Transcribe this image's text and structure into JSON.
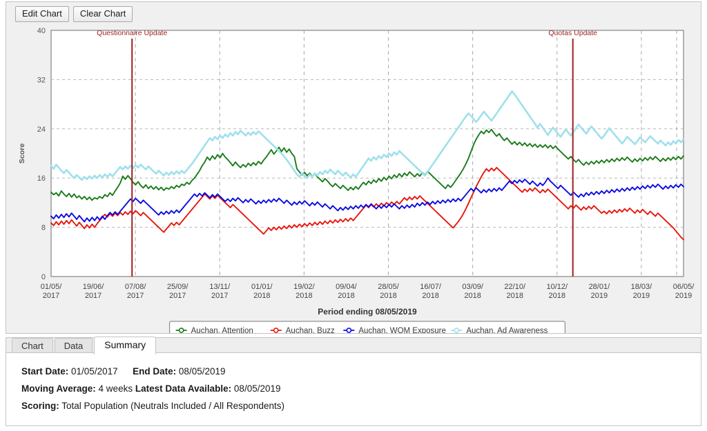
{
  "toolbar": {
    "edit_chart_label": "Edit Chart",
    "clear_chart_label": "Clear Chart"
  },
  "tabs": [
    {
      "label": "Chart",
      "active": false
    },
    {
      "label": "Data",
      "active": false
    },
    {
      "label": "Summary",
      "active": true
    }
  ],
  "summary": {
    "start_date_label": "Start Date:",
    "start_date_value": "01/05/2017",
    "end_date_label": "End Date:",
    "end_date_value": "08/05/2019",
    "moving_average_label": "Moving Average:",
    "moving_average_value": "4 weeks",
    "latest_data_label": "Latest Data Available:",
    "latest_data_value": "08/05/2019",
    "scoring_label": "Scoring:",
    "scoring_value": "Total Population (Neutrals Included / All Respondents)"
  },
  "chart_data": {
    "type": "line",
    "title": "",
    "xlabel": "Period ending 08/05/2019",
    "ylabel": "Score",
    "ylim": [
      0,
      40
    ],
    "yticks": [
      0,
      8,
      16,
      24,
      32,
      40
    ],
    "grid": true,
    "legend_position": "bottom",
    "xticklabels": [
      "01/05/\n2017",
      "19/06/\n2017",
      "07/08/\n2017",
      "25/09/\n2017",
      "13/11/\n2017",
      "01/01/\n2018",
      "19/02/\n2018",
      "09/04/\n2018",
      "28/05/\n2018",
      "16/07/\n2018",
      "03/09/\n2018",
      "22/10/\n2018",
      "10/12/\n2018",
      "28/01/\n2019",
      "18/03/\n2019",
      "06/05/\n2019"
    ],
    "annotations": [
      {
        "label": "Questionnaire Update",
        "x_fraction": 0.128,
        "color": "#9e1f1f"
      },
      {
        "label": "Quotas Update",
        "x_fraction": 0.825,
        "color": "#9e1f1f"
      }
    ],
    "series": [
      {
        "name": "Auchan, Attention",
        "color": "#1a7a1a",
        "values": [
          13.7,
          13.3,
          13.6,
          13.1,
          13.9,
          13.4,
          13.0,
          13.5,
          12.9,
          13.4,
          12.8,
          13.1,
          12.6,
          13.0,
          12.5,
          12.9,
          12.4,
          12.8,
          12.6,
          13.0,
          12.7,
          13.3,
          13.0,
          13.6,
          13.2,
          13.9,
          14.5,
          15.2,
          16.3,
          15.8,
          16.4,
          15.9,
          15.3,
          14.9,
          15.4,
          14.8,
          14.4,
          14.9,
          14.3,
          14.7,
          14.2,
          14.6,
          14.1,
          14.5,
          14.0,
          14.4,
          14.2,
          14.6,
          14.3,
          14.8,
          14.5,
          15.0,
          14.8,
          15.3,
          15.0,
          15.6,
          16.0,
          16.6,
          17.2,
          18.0,
          18.6,
          19.4,
          18.9,
          19.6,
          19.1,
          19.8,
          19.3,
          20.0,
          19.4,
          19.0,
          18.5,
          18.0,
          18.6,
          18.1,
          17.7,
          18.2,
          17.8,
          18.4,
          18.0,
          18.5,
          18.1,
          18.7,
          18.3,
          18.9,
          19.4,
          20.0,
          20.6,
          19.9,
          20.4,
          21.0,
          20.3,
          20.9,
          20.2,
          20.7,
          20.0,
          19.5,
          17.5,
          17.0,
          16.5,
          16.9,
          16.4,
          16.8,
          16.3,
          16.7,
          16.2,
          15.8,
          15.4,
          15.9,
          15.5,
          15.0,
          14.6,
          15.1,
          14.7,
          14.3,
          14.8,
          14.4,
          14.0,
          14.5,
          14.1,
          14.6,
          14.2,
          14.8,
          15.3,
          14.9,
          15.5,
          15.1,
          15.7,
          15.3,
          15.9,
          15.5,
          16.1,
          15.7,
          16.3,
          15.9,
          16.5,
          16.1,
          16.7,
          16.2,
          16.8,
          16.4,
          17.0,
          16.6,
          16.2,
          16.7,
          16.3,
          16.9,
          16.5,
          17.1,
          16.7,
          16.3,
          15.9,
          15.5,
          15.1,
          14.7,
          14.3,
          14.9,
          14.5,
          15.0,
          15.6,
          16.2,
          16.8,
          17.5,
          18.3,
          19.2,
          20.3,
          21.4,
          22.3,
          23.0,
          23.6,
          23.2,
          23.8,
          23.4,
          23.9,
          23.3,
          22.8,
          23.2,
          22.6,
          22.1,
          22.5,
          22.0,
          21.5,
          21.9,
          21.4,
          21.8,
          21.3,
          21.7,
          21.2,
          21.6,
          21.1,
          21.5,
          21.0,
          21.4,
          21.0,
          21.4,
          20.9,
          21.3,
          20.8,
          21.2,
          20.7,
          20.3,
          19.9,
          19.5,
          19.1,
          19.5,
          19.0,
          18.6,
          19.0,
          18.5,
          18.1,
          18.6,
          18.2,
          18.7,
          18.3,
          18.8,
          18.4,
          18.9,
          18.5,
          19.0,
          18.6,
          19.1,
          18.7,
          19.2,
          18.8,
          19.3,
          18.9,
          19.4,
          19.0,
          18.6,
          19.1,
          18.7,
          19.2,
          18.8,
          19.3,
          18.9,
          19.4,
          19.0,
          19.5,
          19.1,
          18.7,
          19.2,
          18.8,
          19.3,
          18.9,
          19.4,
          19.0,
          19.5,
          19.1,
          19.6
        ]
      },
      {
        "name": "Auchan, Buzz",
        "color": "#e8160c",
        "values": [
          8.7,
          8.3,
          8.9,
          8.4,
          9.0,
          8.5,
          9.1,
          8.6,
          9.2,
          8.7,
          8.2,
          8.8,
          8.3,
          7.8,
          8.4,
          7.9,
          8.5,
          8.0,
          8.6,
          9.1,
          9.6,
          10.1,
          9.7,
          10.2,
          9.8,
          10.3,
          9.9,
          10.4,
          10.0,
          10.5,
          10.1,
          10.6,
          10.2,
          10.7,
          10.3,
          9.9,
          10.4,
          10.0,
          9.6,
          9.2,
          8.8,
          8.4,
          8.0,
          7.6,
          7.2,
          7.7,
          8.2,
          8.7,
          8.3,
          8.8,
          8.4,
          8.9,
          9.4,
          9.9,
          10.4,
          10.9,
          11.4,
          11.9,
          12.4,
          12.9,
          13.4,
          13.0,
          12.6,
          13.1,
          12.7,
          13.2,
          12.8,
          12.4,
          12.0,
          11.6,
          11.2,
          11.7,
          11.3,
          10.9,
          10.5,
          10.1,
          9.7,
          9.3,
          8.9,
          8.5,
          8.1,
          7.7,
          7.3,
          6.9,
          7.4,
          7.9,
          7.5,
          8.0,
          7.6,
          8.1,
          7.7,
          8.2,
          7.8,
          8.3,
          7.9,
          8.4,
          8.0,
          8.5,
          8.1,
          8.6,
          8.2,
          8.7,
          8.3,
          8.8,
          8.4,
          8.9,
          8.5,
          9.0,
          8.6,
          9.1,
          8.7,
          9.2,
          8.8,
          9.3,
          8.9,
          9.4,
          9.0,
          9.5,
          9.1,
          9.6,
          10.1,
          10.6,
          11.1,
          11.6,
          11.2,
          11.7,
          11.3,
          11.8,
          11.4,
          11.9,
          11.5,
          12.0,
          11.6,
          12.1,
          11.7,
          12.2,
          11.8,
          12.3,
          12.8,
          12.4,
          12.9,
          12.5,
          13.0,
          12.6,
          13.1,
          12.7,
          12.3,
          11.9,
          11.5,
          11.1,
          10.7,
          10.3,
          9.9,
          9.5,
          9.1,
          8.7,
          8.3,
          7.9,
          8.4,
          8.9,
          9.5,
          10.2,
          11.0,
          11.9,
          12.8,
          13.7,
          14.6,
          15.4,
          16.2,
          16.9,
          17.5,
          17.1,
          17.6,
          17.2,
          17.7,
          17.3,
          16.9,
          16.5,
          16.1,
          15.7,
          15.3,
          14.9,
          14.5,
          14.1,
          13.7,
          14.2,
          13.8,
          14.3,
          13.9,
          14.4,
          14.0,
          13.6,
          14.1,
          13.7,
          14.2,
          13.8,
          13.4,
          13.0,
          12.6,
          12.2,
          11.8,
          11.4,
          11.0,
          11.5,
          11.1,
          11.6,
          11.2,
          10.8,
          11.3,
          10.9,
          11.4,
          11.0,
          11.5,
          11.1,
          10.7,
          10.3,
          10.6,
          10.2,
          10.7,
          10.3,
          10.8,
          10.4,
          10.9,
          10.5,
          11.0,
          10.6,
          11.1,
          10.7,
          10.3,
          10.8,
          10.4,
          10.9,
          10.5,
          10.1,
          10.6,
          10.2,
          9.8,
          10.3,
          9.9,
          9.5,
          9.1,
          8.7,
          8.3,
          7.9,
          7.4,
          6.9,
          6.4,
          6.0
        ]
      },
      {
        "name": "Auchan, WOM Exposure",
        "color": "#0b0be0",
        "values": [
          9.8,
          9.4,
          10.0,
          9.5,
          10.1,
          9.6,
          10.2,
          9.7,
          10.3,
          9.8,
          9.3,
          9.9,
          9.4,
          8.9,
          9.5,
          9.0,
          9.6,
          9.1,
          9.7,
          9.2,
          9.8,
          9.3,
          9.9,
          10.4,
          10.0,
          10.5,
          10.1,
          10.6,
          11.1,
          11.6,
          12.1,
          12.6,
          12.2,
          12.7,
          12.3,
          11.9,
          12.4,
          12.0,
          11.6,
          11.2,
          10.8,
          10.4,
          10.0,
          10.5,
          10.1,
          10.6,
          10.2,
          10.7,
          10.3,
          10.8,
          10.4,
          10.9,
          11.4,
          11.9,
          12.4,
          12.9,
          13.4,
          13.0,
          13.5,
          13.1,
          13.6,
          13.2,
          12.8,
          13.3,
          12.9,
          13.4,
          13.0,
          12.6,
          12.2,
          12.6,
          12.2,
          12.7,
          12.3,
          12.8,
          12.4,
          12.0,
          12.5,
          12.1,
          12.6,
          12.2,
          11.8,
          12.3,
          11.9,
          12.4,
          12.0,
          12.5,
          12.1,
          12.6,
          12.2,
          12.7,
          12.3,
          11.9,
          12.4,
          12.0,
          11.6,
          12.1,
          11.7,
          12.2,
          11.8,
          12.3,
          11.9,
          11.5,
          12.0,
          11.6,
          12.1,
          11.7,
          11.3,
          11.8,
          11.4,
          11.0,
          11.5,
          11.1,
          10.7,
          11.2,
          10.8,
          11.3,
          10.9,
          11.4,
          11.0,
          11.5,
          11.1,
          11.6,
          11.2,
          11.7,
          11.3,
          11.8,
          11.4,
          11.0,
          11.5,
          11.1,
          11.6,
          11.2,
          11.7,
          11.3,
          11.8,
          11.4,
          11.0,
          11.5,
          11.1,
          11.6,
          11.2,
          11.7,
          11.3,
          11.9,
          11.5,
          12.0,
          11.6,
          12.1,
          11.7,
          12.2,
          11.8,
          12.3,
          11.9,
          12.4,
          12.0,
          12.5,
          12.1,
          12.6,
          12.2,
          12.7,
          12.3,
          12.8,
          13.3,
          13.8,
          14.3,
          13.9,
          14.4,
          14.0,
          13.6,
          14.1,
          13.7,
          14.2,
          13.8,
          14.3,
          13.9,
          14.4,
          14.0,
          14.5,
          15.0,
          15.5,
          15.1,
          15.6,
          15.2,
          15.7,
          15.3,
          15.8,
          15.4,
          15.0,
          15.5,
          15.1,
          14.7,
          15.2,
          14.8,
          15.3,
          16.0,
          15.5,
          15.1,
          14.7,
          14.3,
          14.8,
          14.4,
          14.0,
          13.6,
          13.2,
          13.7,
          13.3,
          12.9,
          13.4,
          13.0,
          13.6,
          13.2,
          13.7,
          13.3,
          13.8,
          13.4,
          13.9,
          13.5,
          14.0,
          13.6,
          14.1,
          13.7,
          14.2,
          13.8,
          14.3,
          13.9,
          14.4,
          14.0,
          14.5,
          14.1,
          14.6,
          14.2,
          14.7,
          14.3,
          14.8,
          14.4,
          14.9,
          14.5,
          15.0,
          14.6,
          14.2,
          14.7,
          14.3,
          14.8,
          14.4,
          14.9,
          14.5,
          15.0,
          14.6
        ]
      },
      {
        "name": "Auchan, Ad Awareness",
        "color": "#9fe0ec",
        "values": [
          18.0,
          17.5,
          18.2,
          17.7,
          17.2,
          16.8,
          17.3,
          16.9,
          16.4,
          16.0,
          16.5,
          16.1,
          15.7,
          16.2,
          15.8,
          16.3,
          15.9,
          16.4,
          16.0,
          16.5,
          16.1,
          16.6,
          16.2,
          16.7,
          16.3,
          16.8,
          17.3,
          17.8,
          17.4,
          17.9,
          17.5,
          18.0,
          17.6,
          18.1,
          17.7,
          18.2,
          17.8,
          17.4,
          17.9,
          17.5,
          17.1,
          16.7,
          17.2,
          16.8,
          16.4,
          16.9,
          16.5,
          17.0,
          16.6,
          17.1,
          16.7,
          17.2,
          16.8,
          17.3,
          17.8,
          18.3,
          18.9,
          19.5,
          20.1,
          20.7,
          21.3,
          21.9,
          22.5,
          22.1,
          22.7,
          22.3,
          22.9,
          22.5,
          23.1,
          22.7,
          23.3,
          22.9,
          23.5,
          23.1,
          23.7,
          23.3,
          22.9,
          23.4,
          23.0,
          23.5,
          23.1,
          23.6,
          23.2,
          22.8,
          22.4,
          22.0,
          21.6,
          21.2,
          20.8,
          20.4,
          20.0,
          19.5,
          19.0,
          18.4,
          17.8,
          17.2,
          16.6,
          16.2,
          16.8,
          16.4,
          16.0,
          16.6,
          16.2,
          16.8,
          16.4,
          17.0,
          16.6,
          17.2,
          16.8,
          17.4,
          17.0,
          16.6,
          17.2,
          16.8,
          16.4,
          16.9,
          16.5,
          16.1,
          16.6,
          16.2,
          16.8,
          17.4,
          18.0,
          18.6,
          19.2,
          18.8,
          19.4,
          19.0,
          19.6,
          19.2,
          19.8,
          19.4,
          20.0,
          19.6,
          20.2,
          19.8,
          20.4,
          20.0,
          19.6,
          19.2,
          18.8,
          18.4,
          18.0,
          17.6,
          17.2,
          16.8,
          16.4,
          17.0,
          17.6,
          18.2,
          18.8,
          19.4,
          20.0,
          20.6,
          21.2,
          21.8,
          22.4,
          23.0,
          23.6,
          24.2,
          24.8,
          25.4,
          26.0,
          26.5,
          26.1,
          25.6,
          25.1,
          25.6,
          26.2,
          26.8,
          26.3,
          25.8,
          25.3,
          25.9,
          26.5,
          27.1,
          27.7,
          28.3,
          28.9,
          29.5,
          30.1,
          29.6,
          29.0,
          28.4,
          27.8,
          27.2,
          26.6,
          26.0,
          25.4,
          24.8,
          24.2,
          24.8,
          24.2,
          23.6,
          23.0,
          23.6,
          24.2,
          23.7,
          23.2,
          22.7,
          23.3,
          23.9,
          23.4,
          22.9,
          23.5,
          24.1,
          24.7,
          24.2,
          23.7,
          23.2,
          23.8,
          24.4,
          23.9,
          23.4,
          22.9,
          22.4,
          22.9,
          23.5,
          24.1,
          23.6,
          23.1,
          22.6,
          22.1,
          21.6,
          22.1,
          22.7,
          22.3,
          21.9,
          21.5,
          22.0,
          22.6,
          22.2,
          21.8,
          22.3,
          22.8,
          22.4,
          22.0,
          21.6,
          22.1,
          21.7,
          21.3,
          21.8,
          21.4,
          22.0,
          21.6,
          22.2,
          21.8,
          22.3
        ]
      }
    ]
  }
}
